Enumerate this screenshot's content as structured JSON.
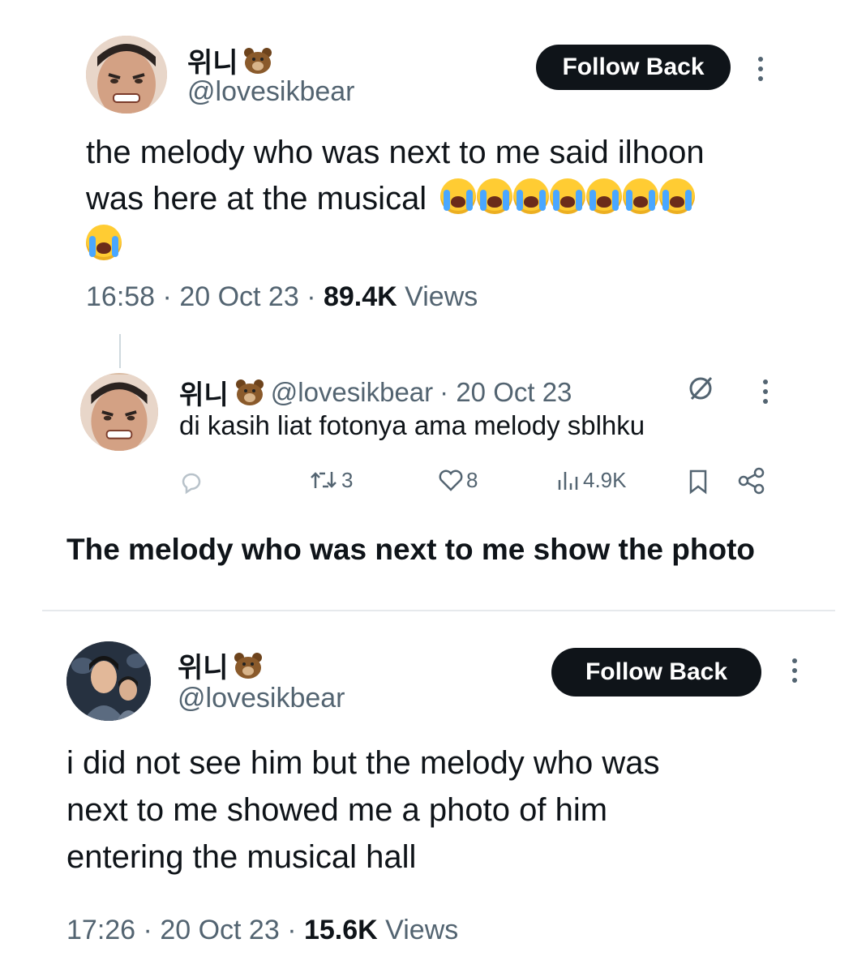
{
  "tweet1": {
    "author_name": "위니",
    "author_handle": "@lovesikbear",
    "follow_label": "Follow Back",
    "text_line1": "the melody who was next to me said ilhoon",
    "text_line2": "was here at the musical",
    "time": "16:58",
    "date": "20 Oct 23",
    "views_count": "89.4K",
    "views_label": "Views",
    "separator": "·"
  },
  "reply": {
    "author_name": "위니",
    "author_handle": "@lovesikbear",
    "date": "· 20 Oct 23",
    "text": "di kasih liat fotonya ama melody sblhku",
    "retweets": "3",
    "likes": "8",
    "views": "4.9K"
  },
  "caption": "The melody who was next to me show the photo",
  "tweet2": {
    "author_name": "위니",
    "author_handle": "@lovesikbear",
    "follow_label": "Follow Back",
    "text_line1": "i did not see him but the melody who was",
    "text_line2": "next to me showed me a photo of him",
    "text_line3": "entering the musical hall",
    "time": "17:26",
    "date": "20 Oct 23",
    "views_count": "15.6K",
    "views_label": "Views",
    "separator": "·"
  },
  "icons": {
    "bear": "bear-emoji-icon",
    "crying": "loudly-crying-face-emoji",
    "reply": "reply-icon",
    "retweet": "retweet-icon",
    "like": "heart-icon",
    "views": "views-chart-icon",
    "bookmark": "bookmark-icon",
    "share": "share-icon",
    "grok": "grok-icon",
    "more": "more-options-icon"
  },
  "colors": {
    "text": "#0f1419",
    "secondary": "#536471",
    "button_bg": "#0f1419",
    "divider": "#e6e9ec"
  }
}
